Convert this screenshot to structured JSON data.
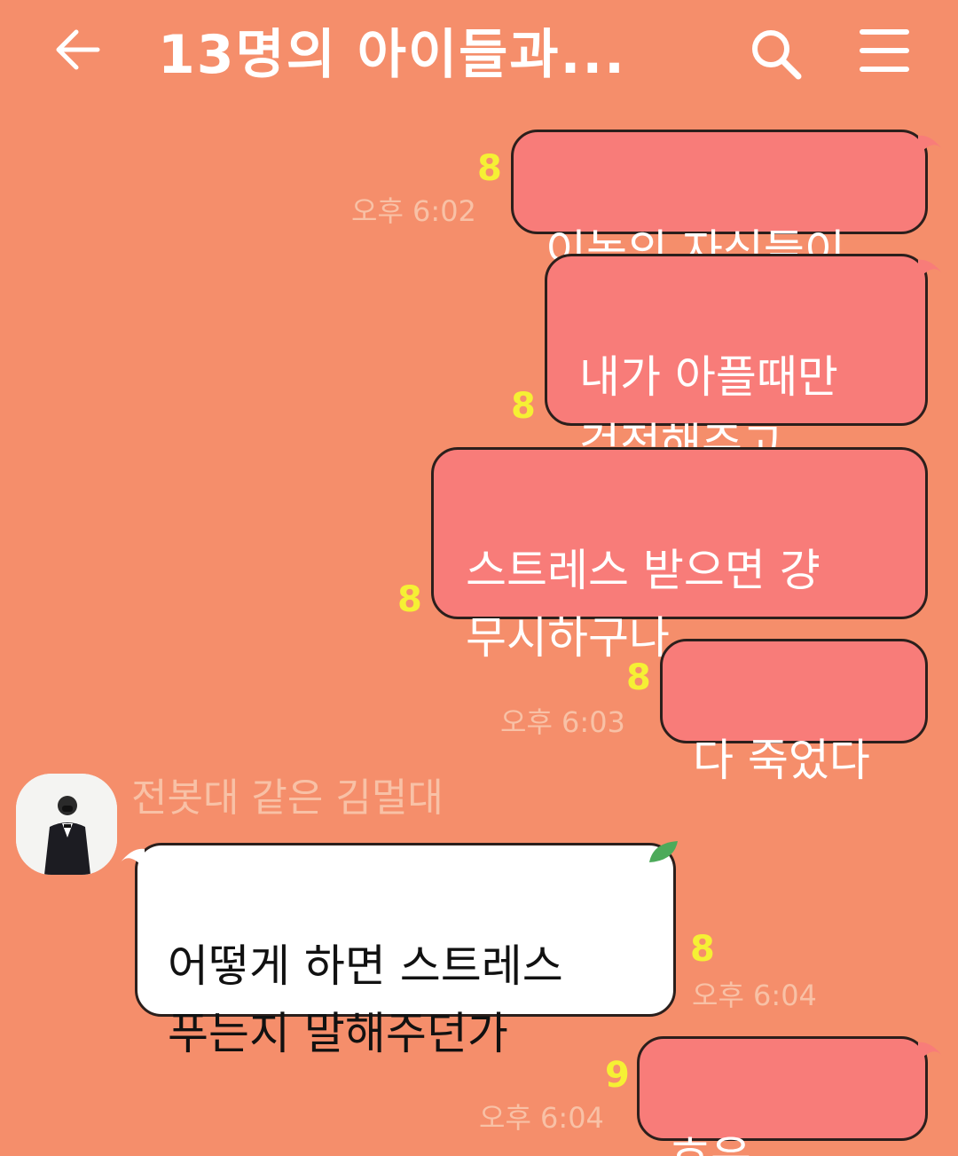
{
  "header": {
    "title": "13명의 아이들과...",
    "back_icon": "back-arrow-icon",
    "search_icon": "search-icon",
    "menu_icon": "hamburger-menu-icon"
  },
  "colors": {
    "background": "#F58E6B",
    "my_bubble": "#F87C79",
    "friend_bubble": "#FFFFFF",
    "unread": "#F5F034",
    "timestamp": "#F8C1A6"
  },
  "messages": [
    {
      "sender": "me",
      "text": "이놈의 자식들이",
      "unread": "8",
      "time": "오후 6:02"
    },
    {
      "sender": "me",
      "text": "내가 아플때만\n걱정해주고",
      "unread": "8",
      "time": ""
    },
    {
      "sender": "me",
      "text": "스트레스 받으면 걍\n무시하구나",
      "unread": "8",
      "time": ""
    },
    {
      "sender": "me",
      "text": "다 죽었다",
      "unread": "8",
      "time": "오후 6:03"
    },
    {
      "sender": "friend",
      "name": "전봇대 같은 김멀대",
      "text": "어떻게 하면 스트레스\n푸는지 말해주던가",
      "unread": "8",
      "time": "오후 6:04"
    },
    {
      "sender": "me",
      "text": "흐음.......",
      "unread": "9",
      "time": "오후 6:04"
    }
  ]
}
